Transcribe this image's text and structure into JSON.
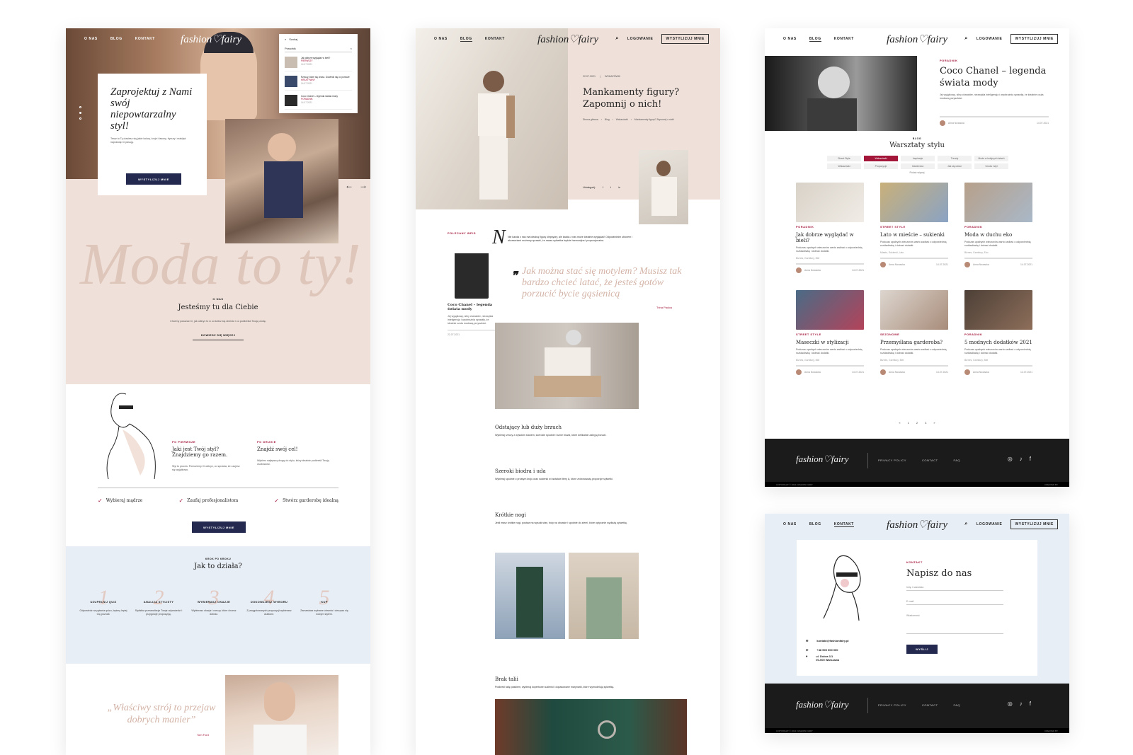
{
  "brand": {
    "logo": "fashion♡fairy",
    "accent": "#a3163a",
    "navy": "#23294f",
    "blush": "#efe0d9",
    "ice": "#e8eef5"
  },
  "nav": {
    "about": "O NAS",
    "blog": "BLOG",
    "contact": "KONTAKT",
    "login": "LOGOWANIE",
    "cta": "WYSTYLIZUJ MNIE"
  },
  "home": {
    "search": {
      "label": "Szukaj",
      "query": "Poradnik",
      "results": [
        {
          "title": "Jak dobrze wyglądać w bieli?",
          "cat": "PIERWSZY",
          "date": "14.07.2021"
        },
        {
          "title": "Rzeczy, które się znasz. Dowiedz się co pomoże",
          "cat": "KREATYWNY",
          "date": "14.07.2021"
        },
        {
          "title": "Coco Chanel – legenda świata mody",
          "cat": "PORADNIK",
          "date": "14.07.2021"
        }
      ]
    },
    "hero": {
      "title": "Zaprojektuj z Nami swój niepowtarzalny styl!",
      "body": "Teraz to Ty dowiesz się jakie kolory, kroje i fasony, fryzury i makijaż naprawdę Ci pasują.",
      "button": "WYSTYLIZUJ MNIE"
    },
    "script": "Moda to ty!",
    "about": {
      "kicker": "O NAS",
      "title": "Jesteśmy tu dla Ciebie",
      "body": "Chcemy pokazać Ci, jak odkryć to w co lubisz się ubierać i co podkreśla Twoją urodę.",
      "button": "DOWIEDZ SIĘ WIĘCEJ"
    },
    "col1": {
      "kicker": "PO PIERWSZE",
      "title": "Jaki jest Twój styl? Znajdziemy go razem.",
      "body": "Styl to proces. Pomożemy Ci odkryć, co sprawia, że czujesz się wyjątkowo."
    },
    "col2": {
      "kicker": "PO DRUGIE",
      "title": "Znajdź swój cel!",
      "body": "Wybierz najlepszą drogę do stylu, który idealnie podkreśli Twoją osobowość."
    },
    "checks": [
      "Wybieraj mądrze",
      "Zaufaj profesjonalistom",
      "Stwórz garderobę idealną"
    ],
    "button2": "WYSTYLIZUJ MNIE",
    "how": {
      "kicker": "KROK PO KROKU",
      "title": "Jak to działa?",
      "steps": [
        {
          "n": "1",
          "t": "UZUPEŁNIJ QUIZ",
          "d": "Odpowiedz na pytania quizu, byśmy lepiej Cię poznali."
        },
        {
          "n": "2",
          "t": "ANALIZA STYLISTY",
          "d": "Stylistka przeanalizuje Twoje odpowiedzi i przygotuje propozycję."
        },
        {
          "n": "3",
          "t": "WYBIERASZ OKAZJE",
          "d": "Wybierasz okazje i rzeczy, które chcesz dobrać."
        },
        {
          "n": "4",
          "t": "DOKONUJESZ WYBORU",
          "d": "Z przygotowanych propozycji wybierasz ulubione."
        },
        {
          "n": "5",
          "t": "KUP",
          "d": "Zamawiasz wybrane ubrania i cieszysz się nowym stylem."
        }
      ]
    },
    "quote": "„Właściwy strój to przejaw dobrych manier”",
    "quote_author": "Tom Ford"
  },
  "article": {
    "date": "22.07.2021",
    "category": "WSKAZÓWKI",
    "title": "Mankamenty figury? Zapomnij o nich!",
    "breadcrumb": [
      "Strona główna",
      "Blog",
      "Wskazówki",
      "Mankamenty figury? Zapomnij o nich!"
    ],
    "share": "Udostępnij:",
    "side": {
      "kicker": "POLECANY WPIS",
      "title": "Coco Chanel – legenda świata mody",
      "body": "Jej wyjątkowy, silny charakter, niezwykła inteligencja i wyobraźnia sprawiły, że idealnie czuła modową przyszłość.",
      "date": "22.07.2021"
    },
    "dropcap": "N",
    "intro": "Nie każda z nas ma idealną figurę klepsydry, ale każda z nas może idealnie wyglądać! Odpowiednim ubiorem i akcesoriami możemy sprawić, że nasza sylwetka będzie harmonijna i proporcjonalna.",
    "pullquote": "Jak można stać się motylem? Musisz tak bardzo chcieć latać, że jesteś gotów porzucić bycie gąsienicą",
    "pull_author": "Trina Paulus",
    "sections": [
      {
        "h": "Odstający lub duży brzuch",
        "p": "Wybieraj rzeczy z wysokim stanem, szerokie spodnie i luźne bluzki, które delikatnie zakryją brzuch."
      },
      {
        "h": "Szeroki biodra i uda",
        "p": "Wybieraj spodnie o prostym kroju oraz sukienki w kształcie litery A, które zrównoważą proporcje sylwetki."
      },
      {
        "h": "Krótkie nogi",
        "p": "Jeśli masz krótkie nogi, postaw na wysoki stan, buty na obcasie i spodnie do ziemi, które optycznie wydłużą sylwetkę."
      },
      {
        "h": "Brak talii",
        "p": "Podkreśl talię paskiem, wybieraj kopertowe sukienki i dopasowane marynarki, które wymodelują sylwetkę."
      }
    ]
  },
  "blog": {
    "featured": {
      "cat": "PORADNIK",
      "title": "Coco Chanel – legenda świata mody",
      "body": "Jej wyjątkowy, silny charakter, niezwykła inteligencja i wyobraźnia sprawiły, że idealnie czuła modową przyszłość.",
      "author": "Anna Nowacka",
      "date": "14.07.2021"
    },
    "kicker": "BLOG",
    "title": "Warsztaty stylu",
    "filters": [
      "Street Style",
      "Wskazówki",
      "Inspiracje",
      "Trendy",
      "Moda w kolejnych latach",
      "Wskazówki",
      "Propozycje",
      "Garderoba",
      "Jak się ubrać",
      "Uroda i styl"
    ],
    "more": "Pokaż więcej",
    "cards": [
      {
        "cat": "PORADNIK",
        "title": "Jak dobrze wyglądać w bieli?",
        "ex": "Podczas upalnych wieczorów warto zadbać o odpowiednią rozkładówkę i dobrać dodatki.",
        "tags": "Biznes, Garnitury, Biel",
        "author": "Anna Nowacka",
        "date": "14.07.2021",
        "c1": "#d8d2c8",
        "c2": "#f1ece6"
      },
      {
        "cat": "STREET STYLE",
        "title": "Lato w mieście – sukienki",
        "ex": "Podczas upalnych wieczorów warto zadbać o odpowiednią rozkładówkę i dobrać dodatki.",
        "tags": "Miasto, Sukienki, Lato",
        "author": "Anna Nowacka",
        "date": "14.07.2021",
        "c1": "#c9b07a",
        "c2": "#8aa3c4"
      },
      {
        "cat": "PORADNIK",
        "title": "Moda w duchu eko",
        "ex": "Podczas upalnych wieczorów warto zadbać o odpowiednią rozkładówkę i dobrać dodatki.",
        "tags": "Biznes, Garnitury, Eko",
        "author": "Anna Nowacka",
        "date": "14.07.2021",
        "c1": "#b7a08a",
        "c2": "#a9b8c8"
      },
      {
        "cat": "STREET STYLE",
        "title": "Maseczki w stylizacji",
        "ex": "Podczas upalnych wieczorów warto zadbać o odpowiednią rozkładówkę i dobrać dodatki.",
        "tags": "Biznes, Garnitury, Biel",
        "author": "Anna Nowacka",
        "date": "14.07.2021",
        "c1": "#4a6b86",
        "c2": "#b3435a"
      },
      {
        "cat": "SEZONOWE",
        "title": "Przemyślana garderoba?",
        "ex": "Podczas upalnych wieczorów warto zadbać o odpowiednią rozkładówkę i dobrać dodatki.",
        "tags": "Biznes, Garnitury, Biel",
        "author": "Anna Nowacka",
        "date": "14.07.2021",
        "c1": "#ddd6cf",
        "c2": "#a88c7a"
      },
      {
        "cat": "PORADNIK",
        "title": "5 modnych dodatków 2021",
        "ex": "Podczas upalnych wieczorów warto zadbać o odpowiednią rozkładówkę i dobrać dodatki.",
        "tags": "Biznes, Garnitury, Biel",
        "author": "Anna Nowacka",
        "date": "14.07.2021",
        "c1": "#4d4037",
        "c2": "#8d6e5a"
      }
    ],
    "pages": [
      "«",
      "1",
      "2",
      "3",
      "»"
    ]
  },
  "footer": {
    "links": [
      "PRIVACY POLICY",
      "CONTACT",
      "FAQ"
    ],
    "copy": "COPYRIGHT © 2021 FASHION FAIRY",
    "credit": "CREATED BY"
  },
  "contact": {
    "kicker": "KONTAKT",
    "title": "Napisz do nas",
    "name_ph": "Imię i nazwisko",
    "email_ph": "E-mail",
    "msg_ph": "Wiadomość",
    "email": "kontakt@fashionfairy.pl",
    "phone": "+48 500 000 000",
    "address1": "ul. Dobra 1/1",
    "address2": "00-000 Warszawa",
    "send": "WYŚLIJ"
  }
}
